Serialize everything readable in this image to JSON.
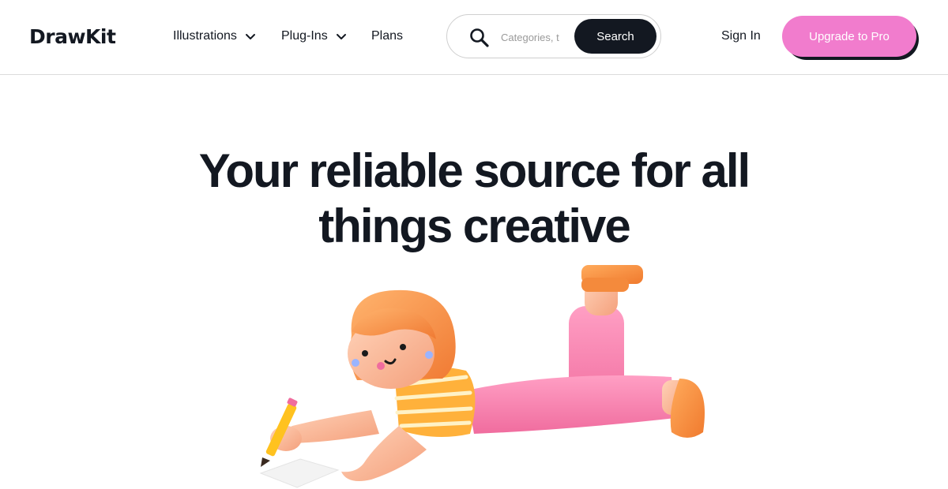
{
  "header": {
    "logo": "DrawKit",
    "nav": [
      {
        "label": "Illustrations",
        "has_dropdown": true
      },
      {
        "label": "Plug-Ins",
        "has_dropdown": true
      },
      {
        "label": "Plans",
        "has_dropdown": false
      }
    ],
    "search": {
      "placeholder": "Categories, t",
      "value": "",
      "button_label": "Search",
      "icon": "search-icon"
    },
    "sign_in": "Sign In",
    "upgrade": "Upgrade to Pro"
  },
  "hero": {
    "title_line1": "Your reliable source for all",
    "title_line2": "things creative"
  },
  "colors": {
    "text": "#131821",
    "accent_pink": "#f17ccd",
    "button_dark": "#131821",
    "divider": "#dcdcdc"
  }
}
